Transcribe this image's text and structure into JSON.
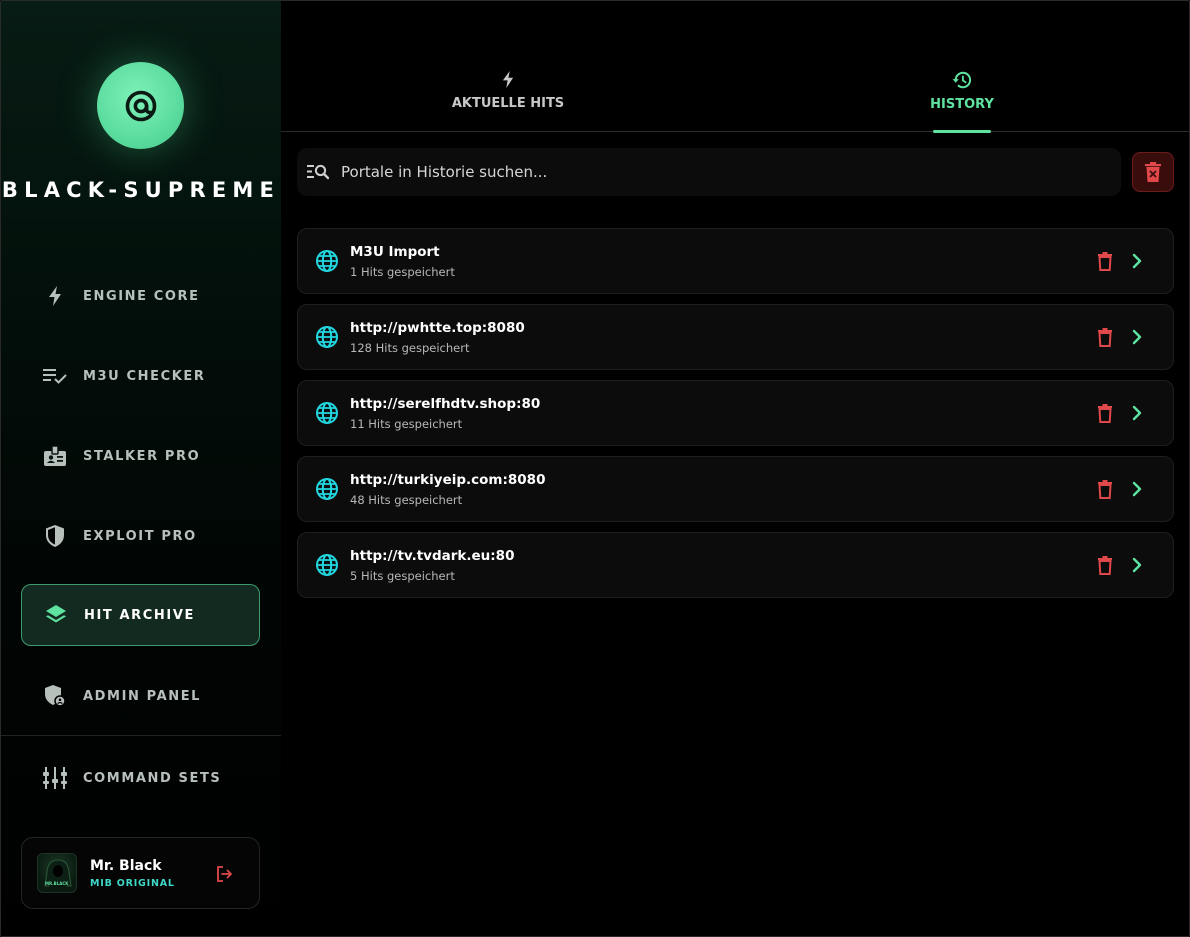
{
  "app": {
    "brand": "BLACK-SUPREME",
    "accent_color": "#5fe3a1",
    "danger_color": "#e0484a",
    "globe_color": "#22d6e0"
  },
  "sidebar": {
    "items": [
      {
        "label": "ENGINE CORE",
        "icon": "bolt-icon",
        "active": false
      },
      {
        "label": "M3U CHECKER",
        "icon": "list-check-icon",
        "active": false
      },
      {
        "label": "STALKER PRO",
        "icon": "badge-icon",
        "active": false
      },
      {
        "label": "EXPLOIT PRO",
        "icon": "shield-icon",
        "active": false
      },
      {
        "label": "HIT ARCHIVE",
        "icon": "layers-icon",
        "active": true
      },
      {
        "label": "ADMIN PANEL",
        "icon": "admin-shield-icon",
        "active": false
      },
      {
        "label": "COMMAND SETS",
        "icon": "sliders-icon",
        "active": false
      }
    ]
  },
  "user": {
    "name": "Mr. Black",
    "role": "MIB ORIGINAL",
    "avatar_text": "MR.BLACK"
  },
  "tabs": [
    {
      "label": "AKTUELLE HITS",
      "icon": "bolt-icon",
      "active": false
    },
    {
      "label": "HISTORY",
      "icon": "history-icon",
      "active": true
    }
  ],
  "search": {
    "placeholder": "Portale in Historie suchen...",
    "value": ""
  },
  "history": [
    {
      "title": "M3U Import",
      "subtitle": "1 Hits gespeichert"
    },
    {
      "title": "http://pwhtte.top:8080",
      "subtitle": "128 Hits gespeichert"
    },
    {
      "title": "http://serelfhdtv.shop:80",
      "subtitle": "11 Hits gespeichert"
    },
    {
      "title": "http://turkiyeip.com:8080",
      "subtitle": "48 Hits gespeichert"
    },
    {
      "title": "http://tv.tvdark.eu:80",
      "subtitle": "5 Hits gespeichert"
    }
  ]
}
